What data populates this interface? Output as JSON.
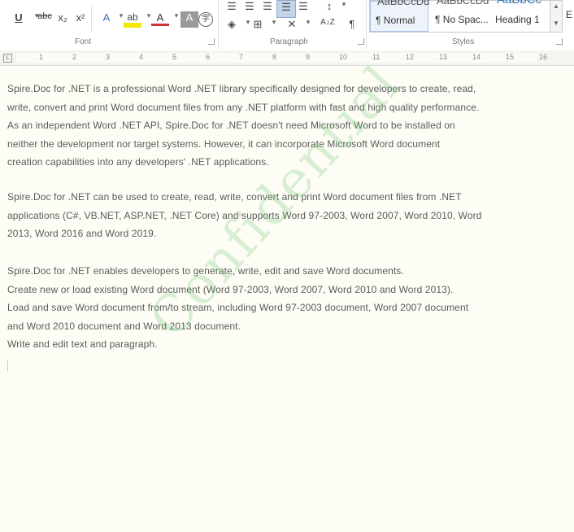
{
  "ribbon": {
    "font_group_label": "Font",
    "paragraph_group_label": "Paragraph",
    "styles_group_label": "Styles",
    "underline": "U",
    "strikethrough": "abc",
    "subscript": "x₂",
    "superscript": "x²",
    "text_effects": "A",
    "highlight": "ab",
    "font_color": "A",
    "char_shading": "A",
    "enclose": "字",
    "pilcrow": "¶",
    "sort": "A↓Z"
  },
  "styles": [
    {
      "preview": "AaBbCcDd",
      "name": "¶ Normal"
    },
    {
      "preview": "AaBbCcDd",
      "name": "¶ No Spac..."
    },
    {
      "preview": "AaBbCc",
      "name": "Heading 1"
    }
  ],
  "ruler": {
    "numbers": [
      "1",
      "2",
      "3",
      "4",
      "5",
      "6",
      "7",
      "8",
      "9",
      "10",
      "11",
      "12",
      "13",
      "14",
      "15",
      "16"
    ]
  },
  "document": {
    "paragraphs": [
      [
        "Spire.Doc for .NET is a professional Word .NET library specifically designed for developers to create, read,",
        "write, convert and print Word document files from any .NET platform with fast and high quality performance.",
        "As an independent Word .NET API, Spire.Doc for .NET doesn't need Microsoft Word to be installed on",
        "neither the development nor target systems. However, it can incorporate Microsoft Word document",
        "creation capabilities into any developers' .NET applications."
      ],
      [
        "Spire.Doc for .NET can be used to create, read, write, convert and print Word document files from .NET",
        "applications (C#, VB.NET, ASP.NET, .NET Core) and supports Word 97-2003, Word 2007, Word 2010, Word",
        "2013, Word 2016 and Word 2019."
      ],
      [
        "Spire.Doc for .NET enables developers to generate, write, edit and save Word documents.",
        "Create new or load existing Word document (Word 97-2003, Word 2007, Word 2010 and Word 2013).",
        "Load and save Word document from/to stream, including Word 97-2003 document, Word 2007 document",
        "and Word 2010 document and Word 2013 document.",
        "Write and edit text and paragraph."
      ]
    ],
    "watermark": "Confidential"
  }
}
